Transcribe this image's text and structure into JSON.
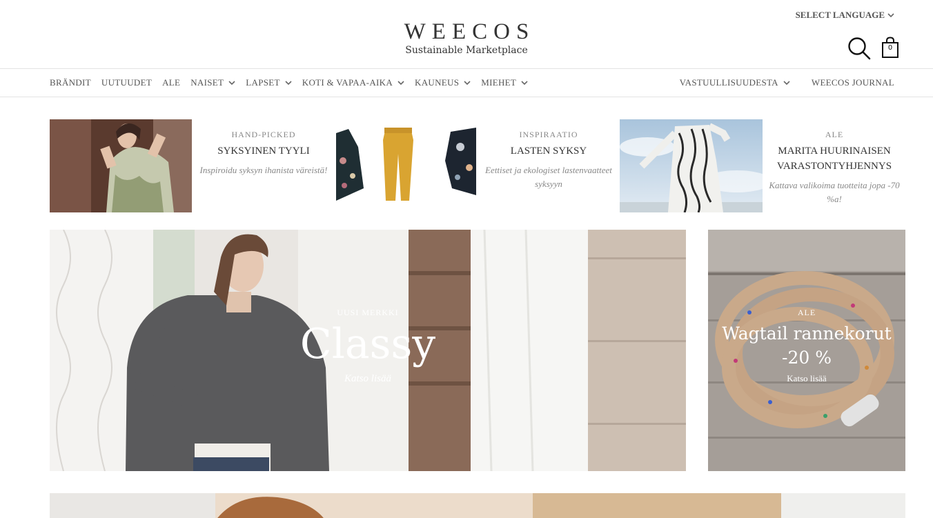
{
  "header": {
    "logo_name": "WEECOS",
    "logo_tagline": "Sustainable Marketplace",
    "language_label": "SELECT LANGUAGE",
    "cart_count": "0"
  },
  "nav": {
    "left": [
      {
        "label": "BRÄNDIT",
        "dropdown": false
      },
      {
        "label": "UUTUUDET",
        "dropdown": false
      },
      {
        "label": "ALE",
        "dropdown": false
      },
      {
        "label": "NAISET",
        "dropdown": true
      },
      {
        "label": "LAPSET",
        "dropdown": true
      },
      {
        "label": "KOTI & VAPAA-AIKA",
        "dropdown": true
      },
      {
        "label": "KAUNEUS",
        "dropdown": true
      },
      {
        "label": "MIEHET",
        "dropdown": true
      }
    ],
    "right": [
      {
        "label": "VASTUULLISUUDESTA",
        "dropdown": true
      },
      {
        "label": "WEECOS JOURNAL",
        "dropdown": false
      }
    ]
  },
  "promos": [
    {
      "kicker": "HAND-PICKED",
      "title": "SYKSYINEN TYYLI",
      "desc": "Inspiroidu syksyn ihanista väreistä!"
    },
    {
      "kicker": "INSPIRAATIO",
      "title": "LASTEN SYKSY",
      "desc": "Eettiset ja ekologiset lastenvaatteet syksyyn"
    },
    {
      "kicker": "ALE",
      "title": "MARITA HUURINAISEN VARASTONTYHJENNYS",
      "desc": "Kattava valikoima tuotteita jopa -70 %a!"
    }
  ],
  "hero": {
    "kicker": "UUSI MERKKI",
    "title": "Classy",
    "link": "Katso lisää"
  },
  "side": {
    "kicker": "ALE",
    "title": "Wagtail rannekorut",
    "discount": "-20 %",
    "link": "Katso lisää"
  },
  "colors": {
    "text": "#333333",
    "muted": "#888888",
    "border": "#e3e3e3",
    "overlay_text": "#ffffff"
  }
}
